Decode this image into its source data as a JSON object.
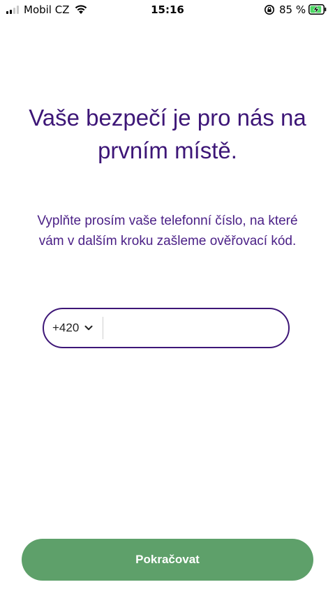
{
  "status_bar": {
    "carrier": "Mobil CZ",
    "time": "15:16",
    "battery_percent": "85 %"
  },
  "content": {
    "title": "Vaše bezpečí je pro nás na prvním místě.",
    "subtitle": "Vyplňte prosím vaše telefonní číslo, na které vám v dalším kroku zašleme ověřovací kód."
  },
  "phone_field": {
    "country_code": "+420",
    "value": "",
    "placeholder": ""
  },
  "actions": {
    "continue_label": "Pokračovat"
  },
  "colors": {
    "title": "#3d1677",
    "field_border": "#3d1677",
    "button_bg": "#5ea06a",
    "battery": "#4cd964"
  },
  "icons": {
    "signal": "cellular-signal-icon",
    "wifi": "wifi-icon",
    "orientation_lock": "orientation-lock-icon",
    "battery": "battery-charging-icon",
    "dropdown": "chevron-down-icon"
  }
}
